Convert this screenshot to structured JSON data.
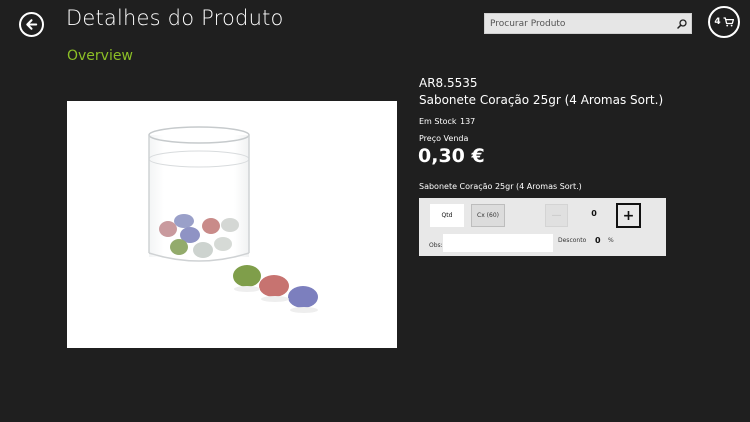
{
  "header": {
    "title": "Detalhes do Produto",
    "subtitle": "Overview",
    "back_icon": "back-arrow-icon",
    "search_placeholder": "Procurar Produto",
    "search_icon": "search-icon",
    "cart_count": "4",
    "cart_icon": "cart-icon"
  },
  "product": {
    "sku": "AR8.5535",
    "name": "Sabonete Coração 25gr (4 Aromas Sort.)",
    "stock_label": "Em Stock",
    "stock_value": "137",
    "price_label": "Preço Venda",
    "price": "0,30 €",
    "description": "Sabonete Coração 25gr (4 Aromas Sort.)"
  },
  "order": {
    "qty_button": "Qtd",
    "box_button": "Cx (60)",
    "minus_label": "—",
    "quantity": "0",
    "plus_label": "+",
    "obs_label": "Obs:",
    "obs_value": "",
    "discount_label": "Desconto",
    "discount_value": "0",
    "discount_unit": "%"
  },
  "colors": {
    "background": "#1f1f1f",
    "accent_green": "#8cbf26",
    "panel": "#e8e8e8"
  }
}
